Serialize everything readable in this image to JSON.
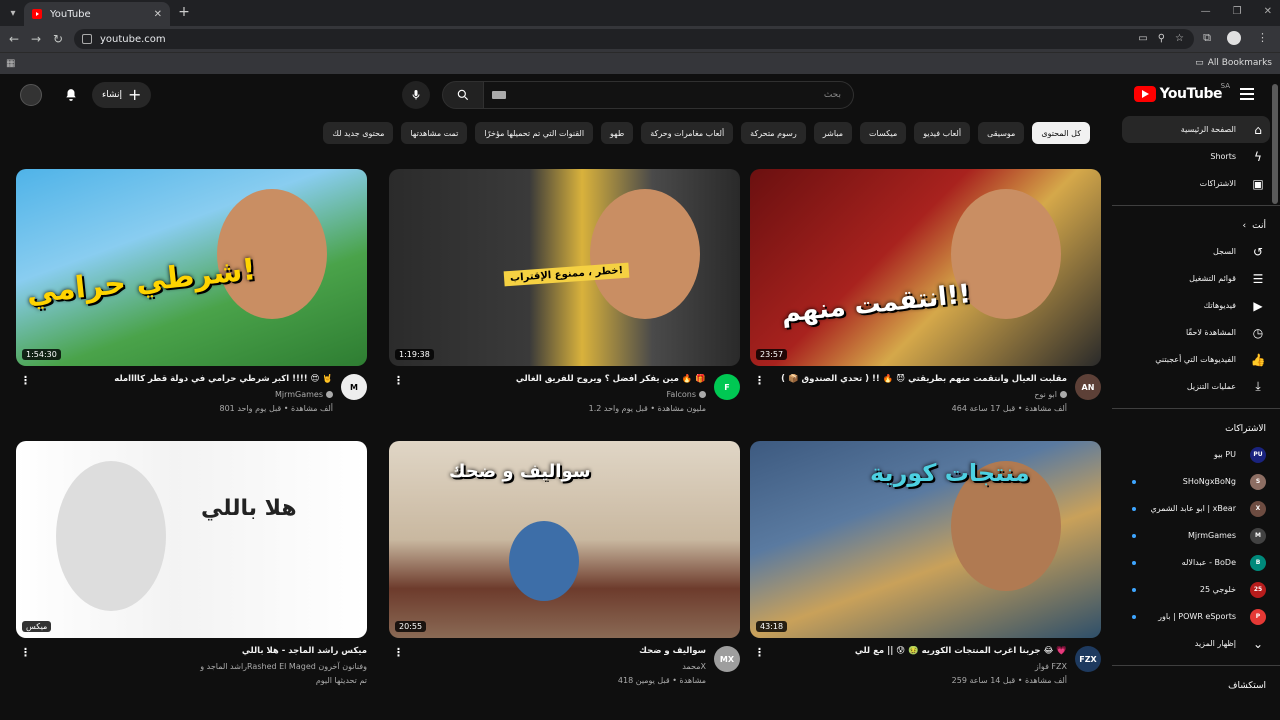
{
  "browser": {
    "tab_title": "YouTube",
    "url": "youtube.com",
    "bookmarks_label": "All Bookmarks"
  },
  "masthead": {
    "logo_text": "YouTube",
    "region": "SA",
    "search_placeholder": "بحث",
    "create_label": "إنشاء"
  },
  "chips": [
    "كل المحتوى",
    "موسيقى",
    "ألعاب فيديو",
    "ميكسات",
    "مباشر",
    "رسوم متحركة",
    "ألعاب مغامرات وحركة",
    "طهو",
    "القنوات التي تم تحميلها مؤخرًا",
    "تمت مشاهدتها",
    "محتوى جديد لك"
  ],
  "sidebar": {
    "main": [
      {
        "label": "الصفحة الرئيسية",
        "icon": "home-icon",
        "glyph": "⌂"
      },
      {
        "label": "Shorts",
        "icon": "shorts-icon",
        "glyph": "ϟ"
      },
      {
        "label": "الاشتراكات",
        "icon": "subscriptions-icon",
        "glyph": "▣"
      }
    ],
    "you_heading": "أنت",
    "you": [
      {
        "label": "السجل",
        "icon": "history-icon",
        "glyph": "↺"
      },
      {
        "label": "قوائم التشغيل",
        "icon": "playlists-icon",
        "glyph": "☰"
      },
      {
        "label": "فيديوهاتك",
        "icon": "your-videos-icon",
        "glyph": "▶"
      },
      {
        "label": "المشاهدة لاحقًا",
        "icon": "watch-later-icon",
        "glyph": "◷"
      },
      {
        "label": "الفيديوهات التي أعجبتني",
        "icon": "liked-icon",
        "glyph": "👍"
      },
      {
        "label": "عمليات التنزيل",
        "icon": "downloads-icon",
        "glyph": "⤓"
      }
    ],
    "subs_heading": "الاشتراكات",
    "subs": [
      {
        "label": "بيو PU",
        "avatar": "PU",
        "color": "#1a237e",
        "dot": false
      },
      {
        "label": "SHoNgxBoNg",
        "avatar": "S",
        "color": "#8d6e63",
        "dot": true
      },
      {
        "label": "ابو عابد الشمري | xBear",
        "avatar": "X",
        "color": "#6d4c41",
        "dot": true
      },
      {
        "label": "MjrmGames",
        "avatar": "M",
        "color": "#424242",
        "dot": true
      },
      {
        "label": "عبدالاله - BoDe",
        "avatar": "B",
        "color": "#00897b",
        "dot": true
      },
      {
        "label": "خلوجي 25",
        "avatar": "25",
        "color": "#b71c1c",
        "dot": true
      },
      {
        "label": "باور | POWR eSports",
        "avatar": "P",
        "color": "#e53935",
        "dot": true
      }
    ],
    "show_more": "إظهار المزيد",
    "explore_heading": "استكشاف"
  },
  "videos": [
    {
      "title": "مقلبت العيال وانتقمت منهم بطريقتي 😈 🔥 !! ( تحدي الصندوق 📦 )",
      "channel": "ابو نوح",
      "verified": true,
      "stats": "464 ألف مشاهدة • قبل 17 ساعة",
      "duration": "23:57",
      "thumb_text": "انتقمت منهم!!",
      "avatar": "AN",
      "avatar_color": "#5d4037"
    },
    {
      "title": "مين يفكر أفضل ؟ ويروح للفريق الغالي 🔥 🎁",
      "channel": "Falcons",
      "verified": true,
      "stats": "1.2 مليون مشاهدة • قبل يوم واحد",
      "duration": "1:19:38",
      "thumb_text": "خطر ، ممنوع الإقتراب!",
      "avatar": "F",
      "avatar_color": "#00c853"
    },
    {
      "title": "اكبر شرطي حرامي في دولة قطر كاااامله !!!! 😍 🤘",
      "channel": "MjrmGames",
      "verified": true,
      "stats": "801 ألف مشاهدة • قبل يوم واحد",
      "duration": "1:54:30",
      "thumb_text": "شرطي حرامي!",
      "avatar": "M",
      "avatar_color": "#eeeeee"
    },
    {
      "title": "جربنا اغرب المنتجات الكوريه 🤢 😰 || مع للي 😂 💗",
      "channel": "فواز FZX",
      "verified": false,
      "stats": "259 ألف مشاهدة • قبل 14 ساعة",
      "duration": "43:18",
      "thumb_text": "منتجات كورية",
      "avatar": "FZX",
      "avatar_color": "#1e3a5f"
    },
    {
      "title": "سواليف و ضحك",
      "channel": "محمدX",
      "verified": false,
      "stats": "418 مشاهدة • قبل يومين",
      "duration": "20:55",
      "thumb_text": "سواليف و ضحك",
      "avatar": "MX",
      "avatar_color": "#9e9e9e"
    },
    {
      "title": "ميكس راشد الماجد - هلا باللي",
      "channel": "راشد الماجد وRashed El Maged وفنانون آخرون",
      "verified": false,
      "stats": "تم تحديثها اليوم",
      "duration": "ميكس",
      "thumb_text": "هلا باللي",
      "avatar": "",
      "avatar_color": "#0f0f0f"
    }
  ]
}
